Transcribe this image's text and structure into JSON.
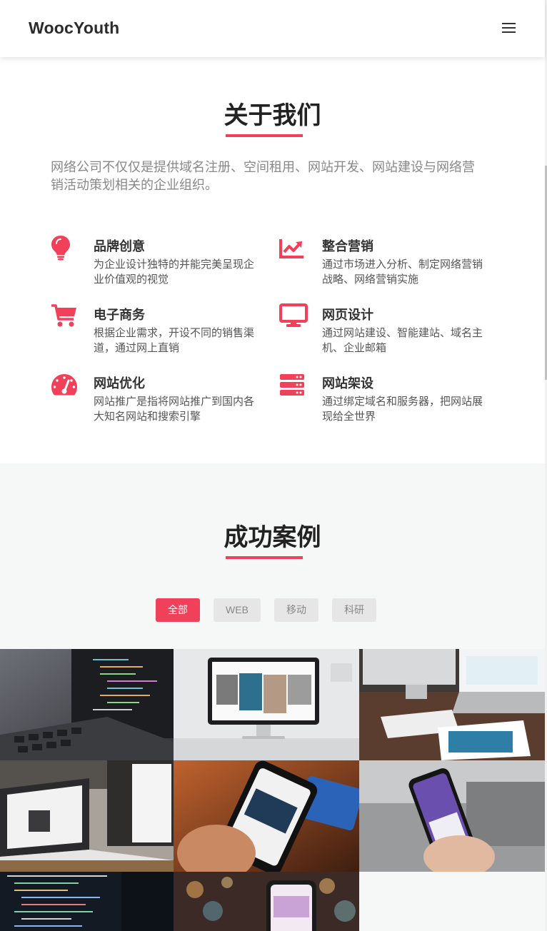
{
  "header": {
    "brand": "WoocYouth",
    "menu_icon": "hamburger-menu-icon"
  },
  "about": {
    "title": "关于我们",
    "description": "网络公司不仅仅是提供域名注册、空间租用、网站开发、网站建设与网络营销活动策划相关的企业组织。",
    "features": [
      {
        "icon": "lightbulb-icon",
        "title": "品牌创意",
        "desc": "为企业设计独特的并能完美呈现企业价值观的视觉"
      },
      {
        "icon": "chart-trend-icon",
        "title": "整合营销",
        "desc": "通过市场进入分析、制定网络营销战略、网络营销实施"
      },
      {
        "icon": "shopping-cart-icon",
        "title": "电子商务",
        "desc": "根据企业需求，开设不同的销售渠道，通过网上直销"
      },
      {
        "icon": "monitor-icon",
        "title": "网页设计",
        "desc": "通过网站建设、智能建站、域名主机、企业邮箱"
      },
      {
        "icon": "speedometer-icon",
        "title": "网站优化",
        "desc": "网站推广是指将网站推广到国内各大知名网站和搜索引擎"
      },
      {
        "icon": "server-icon",
        "title": "网站架设",
        "desc": "通过绑定域名和服务器，把网站展现给全世界"
      }
    ]
  },
  "cases": {
    "title": "成功案例",
    "filters": [
      "全部",
      "WEB",
      "移动",
      "科研"
    ],
    "active_filter": "全部"
  },
  "colors": {
    "accent": "#f0405a",
    "cases_bg": "#f6f7f7"
  }
}
